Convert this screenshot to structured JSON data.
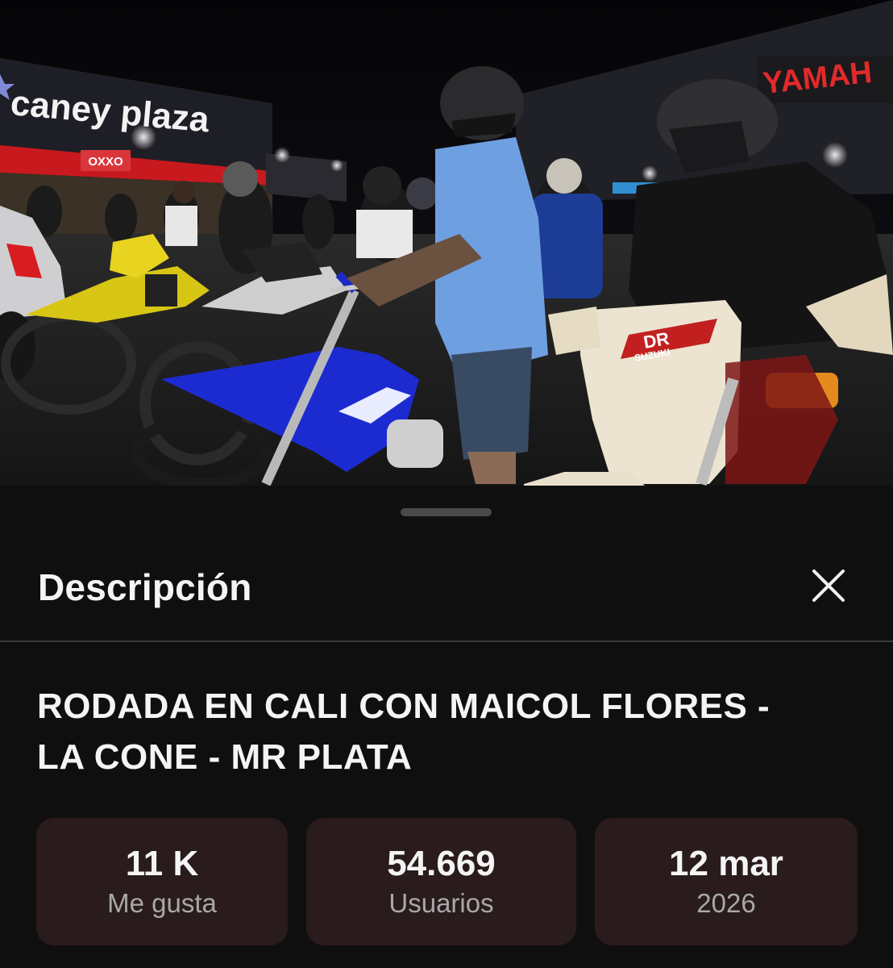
{
  "video": {
    "sign_left": "caney plaza",
    "sign_right": "YAMAH",
    "sign_oxxo": "OXXO",
    "bike_badge": "DR",
    "bike_brand": "SUZUKI"
  },
  "sheet": {
    "title": "Descripción",
    "video_title_line1": "RODADA EN CALI CON MAICOL FLORES -",
    "video_title_line2": "LA CONE - MR PLATA",
    "stats": [
      {
        "value": "11 K",
        "label": "Me gusta"
      },
      {
        "value": "54.669",
        "label": "Usuarios"
      },
      {
        "value": "12 mar",
        "label": "2026"
      }
    ]
  },
  "colors": {
    "background": "#0f0f0f",
    "stat_card": "#2a1b1c",
    "divider": "#3a3a3a"
  }
}
